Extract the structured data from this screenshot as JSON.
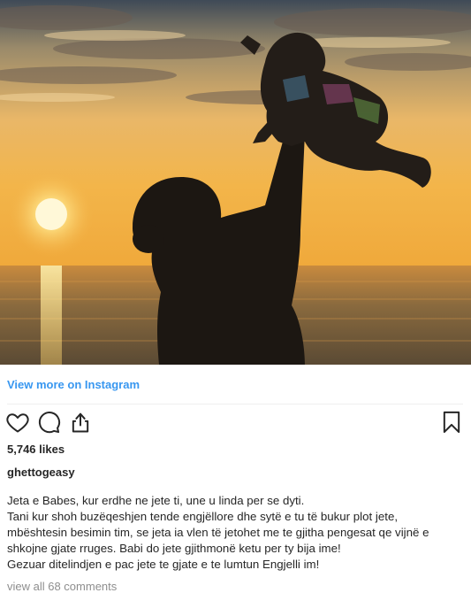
{
  "post": {
    "photo_alt": "",
    "view_more": "View more on Instagram",
    "likes": "5,746 likes",
    "username": "ghettogeasy",
    "caption_lines": [
      "Jeta e Babes, kur erdhe ne jete ti, une u linda per se dyti.",
      "Tani kur shoh buzëqeshjen tende engjëllore dhe sytë e tu të bukur plot jete,",
      "mbështesin besimin tim, se jeta ia vlen të jetohet me te gjitha pengesat qe vijnë e",
      "shkojne gjate rruges. Babi do jete gjithmonë ketu per ty bija ime!",
      "Gezuar ditelindjen e pac jete te gjate e te lumtun Engjelli im!"
    ],
    "view_comments": "view all 68 comments"
  },
  "icons": {
    "like": "heart-icon",
    "comment": "comment-icon",
    "share": "share-icon",
    "save": "bookmark-icon"
  },
  "colors": {
    "link": "#3897f0",
    "text": "#262626",
    "muted": "#8e8e8e"
  }
}
